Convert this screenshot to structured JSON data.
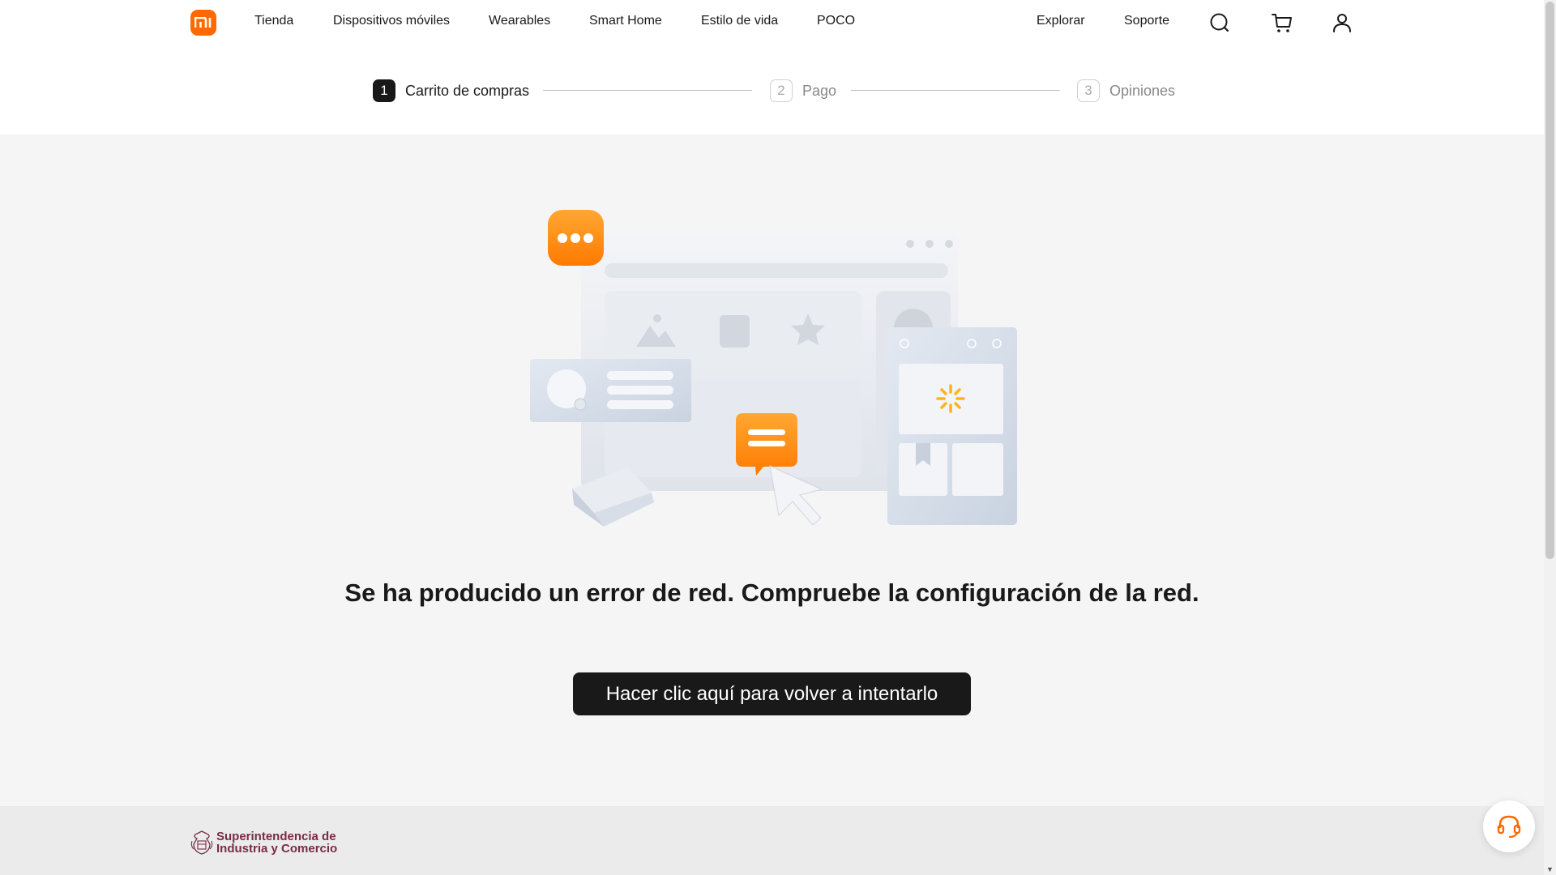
{
  "header": {
    "logo_text": "mi",
    "nav": [
      "Tienda",
      "Dispositivos móviles",
      "Wearables",
      "Smart Home",
      "Estilo de vida",
      "POCO"
    ],
    "right_links": [
      "Explorar",
      "Soporte"
    ],
    "icons": [
      "search-icon",
      "cart-icon",
      "user-icon"
    ]
  },
  "steps": [
    {
      "num": "1",
      "label": "Carrito de compras",
      "state": "active"
    },
    {
      "num": "2",
      "label": "Pago",
      "state": "inactive"
    },
    {
      "num": "3",
      "label": "Opiniones",
      "state": "inactive"
    }
  ],
  "main": {
    "error_message": "Se ha producido un error de red. Compruebe la configuración de la red.",
    "retry_label": "Hacer clic aquí para volver a intentarlo"
  },
  "footer": {
    "sic_line1": "Superintendencia de",
    "sic_line2": "Industria y Comercio"
  },
  "support": {
    "icon": "headset-icon"
  },
  "colors": {
    "brand": "#ff6900",
    "dark": "#191919",
    "sic": "#7a2b45"
  }
}
